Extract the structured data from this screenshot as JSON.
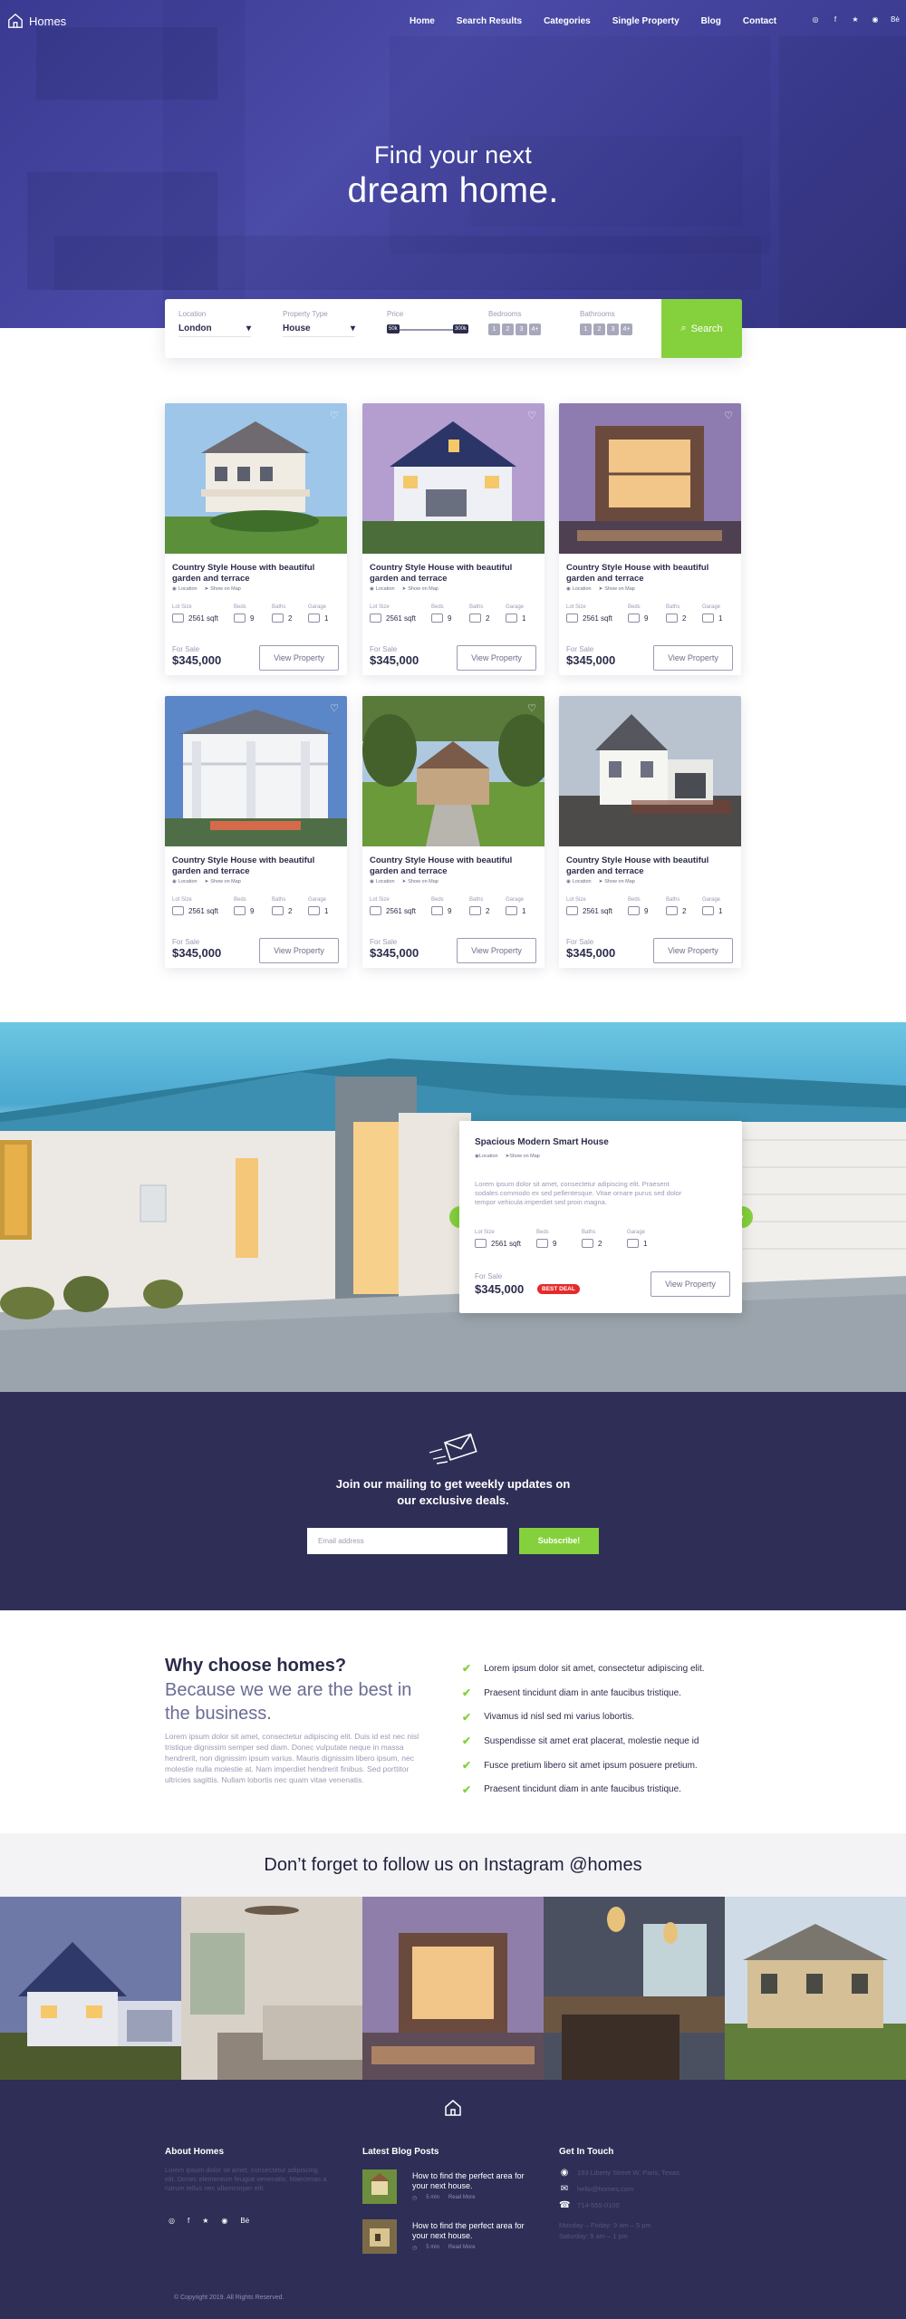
{
  "nav": {
    "brand": "Homes",
    "menu": [
      "Home",
      "Search Results",
      "Categories",
      "Single Property",
      "Blog",
      "Contact"
    ],
    "socials": [
      "◎",
      "f",
      "★",
      "◉",
      "Bė"
    ]
  },
  "hero": {
    "line1": "Find your next",
    "line2": "dream home."
  },
  "search": {
    "location_label": "Location",
    "location_value": "London",
    "type_label": "Property Type",
    "type_value": "House",
    "price_label": "Price",
    "price_min": "50k",
    "price_max": "300k",
    "bedrooms_label": "Bedrooms",
    "bedrooms": [
      "1",
      "2",
      "3",
      "4+"
    ],
    "bathrooms_label": "Bathrooms",
    "bathrooms": [
      "1",
      "2",
      "3",
      "4+"
    ],
    "button": "Search"
  },
  "listing": {
    "title": "Country Style House with beautiful garden and terrace",
    "location": "Location",
    "map": "Show on Map",
    "lot_label": "Lot Size",
    "lot_value": "2561 sqft",
    "beds_label": "Beds",
    "beds_value": "9",
    "baths_label": "Baths",
    "baths_value": "2",
    "garage_label": "Garage",
    "garage_value": "1",
    "sale": "For Sale",
    "price": "$345,000",
    "view": "View Property"
  },
  "feature": {
    "title": "Spacious Modern Smart House",
    "location": "Location",
    "map": "Show on Map",
    "desc": "Lorem ipsum dolor sit amet, consectetur adipiscing elit. Praesent sodales commodo ex sed pellentesque. Vitae ornare purus sed dolor tempor vehicula imperdiet sed proin magna.",
    "lot_label": "Lot Size",
    "lot_value": "2561 sqft",
    "beds_label": "Beds",
    "beds_value": "9",
    "baths_label": "Baths",
    "baths_value": "2",
    "garage_label": "Garage",
    "garage_value": "1",
    "sale": "For Sale",
    "price": "$345,000",
    "badge": "BEST DEAL",
    "view": "View Property",
    "prev": "‹",
    "next": "›"
  },
  "newsletter": {
    "line1": "Join our mailing to get weekly updates on",
    "line2": "our exclusive deals.",
    "placeholder": "Email address",
    "button": "Subscribe!"
  },
  "why": {
    "heading": "Why choose homes?",
    "sub": "Because we we are the best in the business.",
    "body": "Lorem ipsum dolor sit amet, consectetur adipiscing elit. Duis id est nec nisl tristique dignissim semper sed diam. Donec vulputate neque in massa hendrerit, non dignissim ipsum varius. Mauris dignissim libero ipsum, nec molestie nulla molestie at. Nam imperdiet hendrerit finibus. Sed porttitor ultricies sagittis. Nullam lobortis nec quam vitae venenatis.",
    "points": [
      "Lorem ipsum dolor sit amet, consectetur adipiscing elit.",
      "Praesent tincidunt diam in ante faucibus tristique.",
      "Vivamus id nisl sed mi varius lobortis.",
      "Suspendisse sit amet erat placerat, molestie neque id",
      "Fusce pretium libero sit amet ipsum posuere pretium.",
      "Praesent tincidunt diam in ante faucibus tristique."
    ]
  },
  "instagram": {
    "title": "Don’t forget to follow us on Instagram @homes"
  },
  "footer": {
    "about_title": "About Homes",
    "about_text": "Lorem ipsum dolor sit amet, consectetur adipiscing elit. Donec elementum feugiat venenatis. Maecenas a rutrum tellus nec ullamcorper elit.",
    "socials": [
      "◎",
      "f",
      "★",
      "◉",
      "Bė"
    ],
    "blog_title": "Latest Blog Posts",
    "posts": [
      {
        "title": "How to find the perfect area for your next house.",
        "time": "5 min",
        "more": "Read More"
      },
      {
        "title": "How to find the perfect area for your next house.",
        "time": "5 min",
        "more": "Read More"
      }
    ],
    "touch_title": "Get In Touch",
    "address": "193 Liberty Street W, Paris, Texas",
    "email": "hello@homes.com",
    "phone": "714-555-0100",
    "hours1": "Monday – Friday: 9 am – 5 pm",
    "hours2": "Saturday: 9 am – 1 pm",
    "copyright": "© Copyright 2019. All Rights Reserved."
  },
  "colors": {
    "primary": "#2e2e56",
    "accent": "#85d13d",
    "hero": "#3e3e96",
    "badge": "#e62a2a"
  }
}
